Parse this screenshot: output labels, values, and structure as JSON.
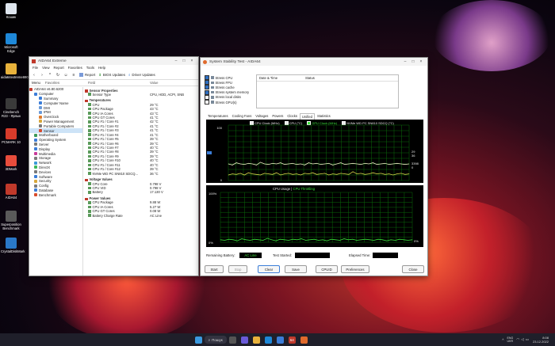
{
  "desktop": {
    "icons": [
      {
        "label": "Кошик",
        "color": "#dfe6ee"
      },
      {
        "label": "Microsoft Edge",
        "color": "#1e88d8"
      },
      {
        "label": "aida64extreme690",
        "color": "#e8b23c"
      },
      {
        "label": "Cinebench R23 - Ярлык",
        "color": "#3a3a3a"
      },
      {
        "label": "PCMARK 10",
        "color": "#d83b2b"
      },
      {
        "label": "3DMark",
        "color": "#e84c3c"
      },
      {
        "label": "AIDA64",
        "color": "#c0392b"
      },
      {
        "label": "Superposition Benchmark",
        "color": "#5a5a5a"
      },
      {
        "label": "CrystalDiskMark",
        "color": "#2a78c8"
      }
    ]
  },
  "aida": {
    "title": "AIDA64 Extreme",
    "menu": [
      "File",
      "View",
      "Report",
      "Favorites",
      "Tools",
      "Help"
    ],
    "toolbar": {
      "report": "Report",
      "bios_updates": "BIOS Updates",
      "driver_updates": "Driver Updates"
    },
    "pane_tabs": [
      "Menu",
      "Favorites"
    ],
    "version": "AIDA64 v6.80.6200",
    "tree": [
      {
        "label": "Computer",
        "indent": 1,
        "color": "#3b7dd8"
      },
      {
        "label": "Summary",
        "indent": 2,
        "color": "#3b7dd8"
      },
      {
        "label": "Computer Name",
        "indent": 2,
        "color": "#3b7dd8"
      },
      {
        "label": "DMI",
        "indent": 2,
        "color": "#6a9ad8"
      },
      {
        "label": "IPMI",
        "indent": 2,
        "color": "#6a9ad8"
      },
      {
        "label": "Overclock",
        "indent": 2,
        "color": "#e07b2c"
      },
      {
        "label": "Power Management",
        "indent": 2,
        "color": "#d8a83b"
      },
      {
        "label": "Portable Computers",
        "indent": 2,
        "color": "#7a7a7a"
      },
      {
        "label": "Sensor",
        "indent": 2,
        "color": "#d84c2c",
        "selected": true
      },
      {
        "label": "Motherboard",
        "indent": 1,
        "color": "#3b9a5a"
      },
      {
        "label": "Operating System",
        "indent": 1,
        "color": "#3b7dd8"
      },
      {
        "label": "Server",
        "indent": 1,
        "color": "#7a7a7a"
      },
      {
        "label": "Display",
        "indent": 1,
        "color": "#3b7dd8"
      },
      {
        "label": "Multimedia",
        "indent": 1,
        "color": "#c83b9a"
      },
      {
        "label": "Storage",
        "indent": 1,
        "color": "#7a7a7a"
      },
      {
        "label": "Network",
        "indent": 1,
        "color": "#3b9ad8"
      },
      {
        "label": "DirectX",
        "indent": 1,
        "color": "#3bb85a"
      },
      {
        "label": "Devices",
        "indent": 1,
        "color": "#7a7a7a"
      },
      {
        "label": "Software",
        "indent": 1,
        "color": "#3b7dd8"
      },
      {
        "label": "Security",
        "indent": 1,
        "color": "#d8a83b"
      },
      {
        "label": "Config",
        "indent": 1,
        "color": "#7a7a7a"
      },
      {
        "label": "Database",
        "indent": 1,
        "color": "#3b7dd8"
      },
      {
        "label": "Benchmark",
        "indent": 1,
        "color": "#d84c2c"
      }
    ],
    "columns": {
      "field": "Field",
      "value": "Value"
    },
    "sensor_props": {
      "header": "Sensor Properties",
      "rows": [
        {
          "field": "Sensor Type",
          "value": "CPU, HDD, ACPI, SNB"
        }
      ]
    },
    "temperatures": {
      "header": "Temperatures",
      "rows": [
        {
          "field": "CPU",
          "value": "29 °C"
        },
        {
          "field": "CPU Package",
          "value": "43 °C"
        },
        {
          "field": "CPU IA Cores",
          "value": "43 °C"
        },
        {
          "field": "CPU GT Cores",
          "value": "41 °C"
        },
        {
          "field": "CPU #1 / Core #1",
          "value": "42 °C"
        },
        {
          "field": "CPU #1 / Core #2",
          "value": "41 °C"
        },
        {
          "field": "CPU #1 / Core #3",
          "value": "41 °C"
        },
        {
          "field": "CPU #1 / Core #4",
          "value": "41 °C"
        },
        {
          "field": "CPU #1 / Core #5",
          "value": "39 °C"
        },
        {
          "field": "CPU #1 / Core #6",
          "value": "39 °C"
        },
        {
          "field": "CPU #1 / Core #7",
          "value": "40 °C"
        },
        {
          "field": "CPU #1 / Core #8",
          "value": "39 °C"
        },
        {
          "field": "CPU #1 / Core #9",
          "value": "39 °C"
        },
        {
          "field": "CPU #1 / Core #10",
          "value": "40 °C"
        },
        {
          "field": "CPU #1 / Core #11",
          "value": "40 °C"
        },
        {
          "field": "CPU #1 / Core #12",
          "value": "39 °C"
        },
        {
          "field": "NVMe WD PC SN810 SDCQ...",
          "value": "36 °C"
        }
      ]
    },
    "voltages": {
      "header": "Voltage Values",
      "rows": [
        {
          "field": "CPU Core",
          "value": "0.798 V"
        },
        {
          "field": "CPU VID",
          "value": "0.798 V"
        },
        {
          "field": "Battery",
          "value": "17.130 V"
        }
      ]
    },
    "power": {
      "header": "Power Values",
      "rows": [
        {
          "field": "CPU Package",
          "value": "9.88 W"
        },
        {
          "field": "CPU IA Cores",
          "value": "5.27 W"
        },
        {
          "field": "CPU GT Cores",
          "value": "0.08 W"
        },
        {
          "field": "Battery Charge Rate",
          "value": "AC Line"
        }
      ]
    }
  },
  "sst": {
    "title": "System Stability Test - AIDA64",
    "stress": [
      {
        "label": "Stress CPU",
        "checked": true
      },
      {
        "label": "Stress FPU",
        "checked": true
      },
      {
        "label": "Stress cache",
        "checked": true
      },
      {
        "label": "Stress system memory",
        "checked": true
      },
      {
        "label": "Stress local disks",
        "checked": false
      },
      {
        "label": "Stress GPU(s)",
        "checked": false
      }
    ],
    "log_headers": {
      "datetime": "Date & Time",
      "status": "Status"
    },
    "tabs": [
      "Temperatures",
      "Cooling Fans",
      "Voltages",
      "Powers",
      "Clocks",
      "Unified",
      "Statistics"
    ],
    "active_tab": "Unified",
    "graph1": {
      "legend": [
        "CPU Clock (MHz)",
        "CPU (°C)",
        "GPU Clock (MHz)",
        "NVMe WD PC SN810 SDCQ (°C)"
      ],
      "legend_colors": [
        "#e8e8e8",
        "#e8e8e8",
        "#3be03b",
        "#e8e8e8"
      ],
      "ymax": "100",
      "ymin": "0",
      "right_labels": [
        "29",
        "36",
        "3398",
        "0"
      ]
    },
    "graph2": {
      "title_a": "CPU Usage",
      "sep": "|",
      "title_b": "CPU Throttling",
      "ymax": "100%",
      "ymin": "0%",
      "right_label": "0%"
    },
    "status": {
      "remaining_battery_label": "Remaining Battery:",
      "remaining_battery_value": "AC Line",
      "test_started_label": "Test Started:",
      "test_started_value": "",
      "elapsed_label": "Elapsed Time:",
      "elapsed_value": ""
    },
    "buttons": {
      "start": "Start",
      "stop": "Stop",
      "clear": "Clear",
      "save": "Save",
      "cpuid": "CPUID",
      "preferences": "Preferences",
      "close": "Close"
    }
  },
  "taskbar": {
    "search": "Пошук",
    "badge": "64",
    "lang": "ENG\nUKR",
    "time": "8:08",
    "date": "23.12.2022"
  },
  "chart_data": [
    {
      "type": "line",
      "title": "",
      "series": [
        {
          "name": "CPU Clock (MHz)",
          "values": [
            10,
            12,
            11,
            13,
            10,
            14,
            12,
            11,
            10,
            13,
            12,
            11,
            14,
            10,
            12,
            13,
            11,
            12,
            10,
            13,
            12,
            14,
            11,
            12,
            13,
            10,
            12,
            11,
            13,
            12,
            11,
            16,
            12,
            13,
            11,
            12,
            14,
            12,
            13,
            11,
            12,
            10,
            12,
            13,
            11,
            12
          ]
        },
        {
          "name": "CPU (°C)",
          "values": [
            30,
            28,
            32,
            30,
            29,
            31,
            30,
            28,
            33,
            30,
            29,
            31,
            30,
            32,
            29,
            30,
            31,
            29,
            30,
            28,
            32,
            30,
            31,
            29,
            30,
            31,
            28,
            30,
            32,
            29,
            30,
            31,
            30,
            29,
            31,
            30,
            32,
            29,
            30,
            31,
            29,
            30,
            31,
            30,
            29,
            30
          ]
        }
      ],
      "ylim": [
        0,
        100
      ]
    },
    {
      "type": "line",
      "title": "",
      "series": [
        {
          "name": "CPU Usage",
          "values": [
            5,
            4,
            6,
            5,
            3,
            7,
            5,
            4,
            6,
            5,
            4,
            8,
            5,
            3,
            6,
            5,
            4,
            6,
            5,
            7,
            4,
            5,
            6,
            4,
            5,
            3,
            6,
            5,
            4,
            7,
            5,
            6,
            4,
            5,
            6,
            5,
            4,
            6,
            5,
            3,
            5,
            4,
            6,
            5,
            4,
            5
          ]
        }
      ],
      "ylim": [
        0,
        100
      ]
    }
  ]
}
